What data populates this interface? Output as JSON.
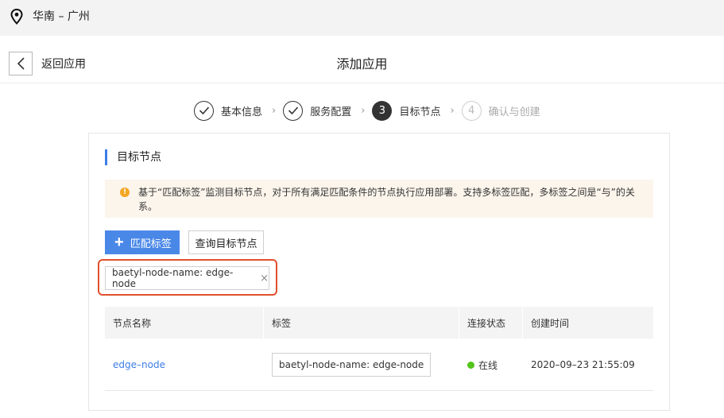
{
  "topbar": {
    "region": "华南 – 广州",
    "icon": "location-pin-icon"
  },
  "header": {
    "back_label": "返回应用",
    "title": "添加应用"
  },
  "steps": [
    {
      "num": "1",
      "label": "基本信息",
      "state": "done"
    },
    {
      "num": "2",
      "label": "服务配置",
      "state": "done"
    },
    {
      "num": "3",
      "label": "目标节点",
      "state": "active"
    },
    {
      "num": "4",
      "label": "确认与创建",
      "state": "pending"
    }
  ],
  "card": {
    "title": "目标节点",
    "notice": "基于“匹配标签”监测目标节点，对于所有满足匹配条件的节点执行应用部署。支持多标签匹配，多标签之间是“与”的关系。",
    "add_label_button": "匹配标签",
    "query_button": "查询目标节点",
    "tag_chip": "baetyl-node-name: edge-node",
    "tag_chip_close": "×"
  },
  "table": {
    "headers": [
      "节点名称",
      "标签",
      "连接状态",
      "创建时间"
    ],
    "rows": [
      {
        "name": "edge–node",
        "tag": "baetyl-node-name: edge-node",
        "status": "在线",
        "created": "2020–09–23 21:55:09"
      }
    ]
  },
  "colors": {
    "accent": "#4a88e8",
    "link": "#3d7ee6",
    "online": "#52c41a",
    "highlight": "#e0502c",
    "notice_bg": "#fcf5ec"
  }
}
